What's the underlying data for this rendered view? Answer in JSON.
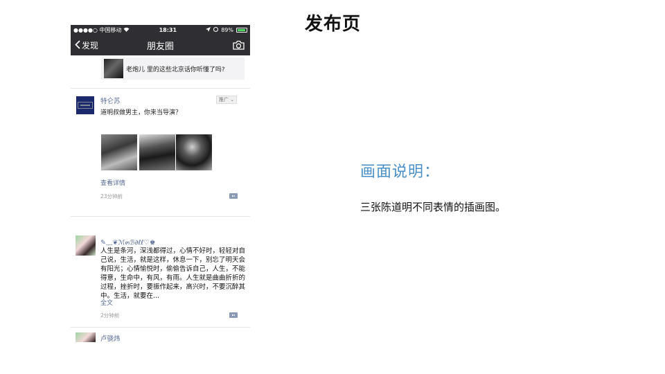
{
  "slide": {
    "title": "发布页",
    "desc_heading": "画面说明：",
    "desc_text": "三张陈道明不同表情的插画图。"
  },
  "statusbar": {
    "carrier": "●●●●○ 中国移动",
    "time": "18:31",
    "battery": "89%",
    "battery_level": 0.89
  },
  "navbar": {
    "back_label": "发现",
    "title": "朋友圈"
  },
  "shared_card": {
    "text": "老炮儿 里的这些北京话你听懂了吗?"
  },
  "ad_post": {
    "name": "特仑苏",
    "badge": "推广 ⌄",
    "text": "道明叔做男主，你来当导演？",
    "link": "查看详情",
    "time": "23分钟前"
  },
  "user_post": {
    "name": "✎﹏❦ℳ๓ℬ∂ℓℓ♡♚",
    "body": "人生是条河，深浅都得过，心情不好时，轻轻对自己说，生活，就是这样，休息一下，别忘了明天会有阳光；心情愉悦时，偷偷告诉自己，人生，不能得意，生命中，有风，有雨。人生就是曲曲折折的过程，挫折时，要振作起来，高兴时，不要沉醉其中。生活，就要在...",
    "link": "全文",
    "time": "2分钟前"
  },
  "next_post": {
    "name": "卢骁炜"
  }
}
